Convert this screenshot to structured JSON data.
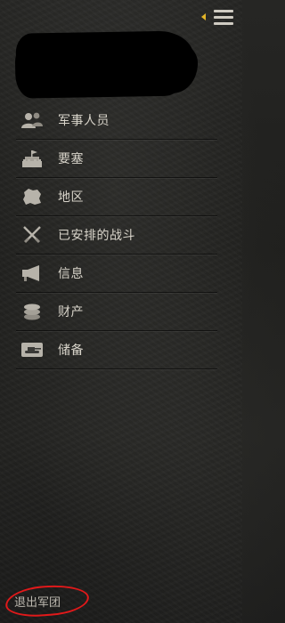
{
  "header": {
    "menu_icon": "hamburger-menu-icon",
    "accent_color": "#e2b428"
  },
  "nav": {
    "items": [
      {
        "label": "军事人员",
        "icon": "personnel-icon"
      },
      {
        "label": "要塞",
        "icon": "fortress-icon"
      },
      {
        "label": "地区",
        "icon": "region-map-icon"
      },
      {
        "label": "已安排的战斗",
        "icon": "crossed-swords-icon"
      },
      {
        "label": "信息",
        "icon": "megaphone-icon"
      },
      {
        "label": "财产",
        "icon": "coins-icon"
      },
      {
        "label": "储备",
        "icon": "tank-icon"
      }
    ]
  },
  "footer": {
    "leave_label": "退出军团",
    "highlight_color": "#e0191a"
  }
}
